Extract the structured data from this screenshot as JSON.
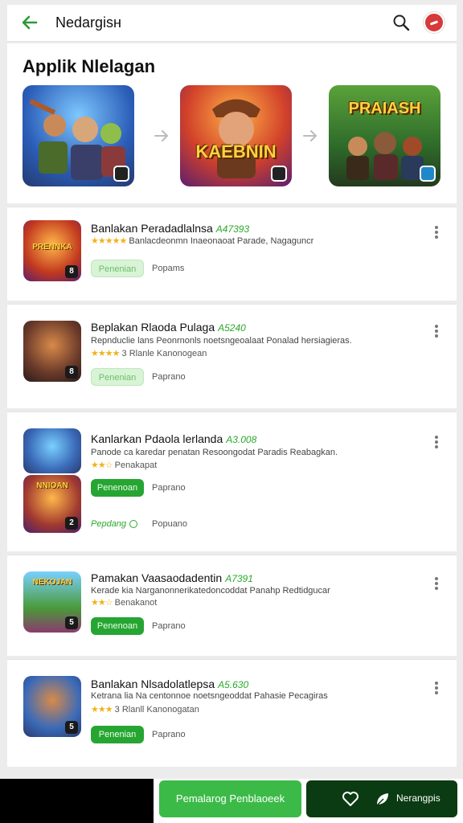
{
  "header": {
    "title": "Nedargisн"
  },
  "featured": {
    "heading": "Applik Nlelagan",
    "items": [
      {
        "art_text": ""
      },
      {
        "art_text": "KAEBNIN"
      },
      {
        "art_text": "PRAIASH"
      }
    ]
  },
  "apps": [
    {
      "title": "Banlakan Peradadlalnsa",
      "price": "A47393",
      "desc": "Banlacdeonmn Inaeonaoat Parade, Nagaguncr",
      "stars": "★★★★★",
      "rating_text": "",
      "icon_text": "PRENNKA",
      "icon_num": "8",
      "get_label": "Penenian",
      "link_label": "Popams"
    },
    {
      "title": "Beplakan Rlaoda Pulaga",
      "price": "A5240",
      "desc": "Repnduclie lans Peonrnonls noetsngeoalaat Ponalad hersiagieras.",
      "stars": "★★★★",
      "rating_text": "3 Rlanle Kanonogean",
      "icon_text": "",
      "icon_num": "8",
      "get_label": "Penenian",
      "link_label": "Paprano"
    },
    {
      "title": "Kanlarkan Pdaola lerlanda",
      "price": "A3.008",
      "desc": "Panode ca karedar penatan Resoongodat Paradis Reabagkan.",
      "stars": "★★☆",
      "rating_text": "Penakapat",
      "icon_text": "NNIOAN",
      "icon_num": "2",
      "get_label": "Penenoan",
      "link_label": "Paprano",
      "recommend": "Pepdang",
      "link2_label": "Popuano"
    },
    {
      "title": "Pamakan Vaasaodadentin",
      "price": "A7391",
      "desc": "Kerade kia Narganonnerikatedoncoddat Panahp Redtidgucar",
      "stars": "★★☆",
      "rating_text": "Benakanot",
      "icon_text": "NEKOJAN",
      "icon_num": "5",
      "get_label": "Penenoan",
      "link_label": "Paprano"
    },
    {
      "title": "Banlakan Nlsadolatlepsa",
      "price": "A5.630",
      "desc": "Ketrana lia Na centonnoe noetsngeoddat Pahasie Pecagiras",
      "stars": "★★★",
      "rating_text": "3 Rlanll Kanonogatan",
      "icon_text": "",
      "icon_num": "5",
      "get_label": "Penenian",
      "link_label": "Paprano"
    }
  ],
  "bottom": {
    "primary_label": "Pemalarog Penblaoeek",
    "secondary_label": "Nerangpis"
  },
  "colors": {
    "accent": "#26a532",
    "price": "#2aa82a",
    "star": "#f2b21b"
  }
}
